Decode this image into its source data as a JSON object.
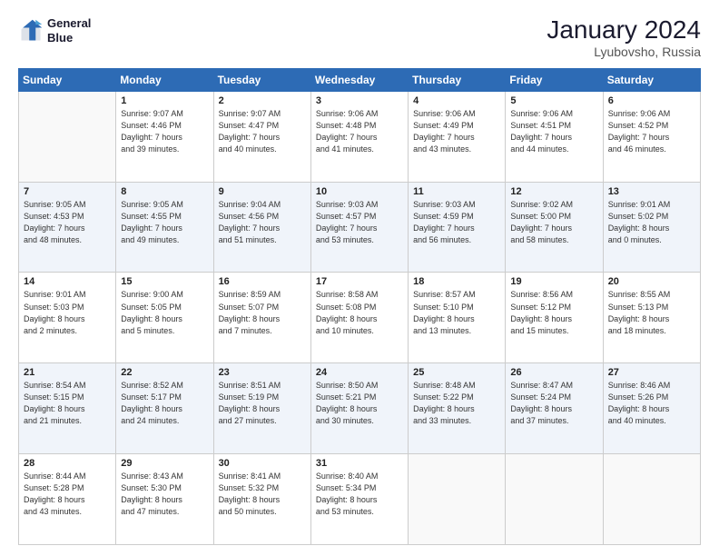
{
  "header": {
    "logo_line1": "General",
    "logo_line2": "Blue",
    "month": "January 2024",
    "location": "Lyubovsho, Russia"
  },
  "weekdays": [
    "Sunday",
    "Monday",
    "Tuesday",
    "Wednesday",
    "Thursday",
    "Friday",
    "Saturday"
  ],
  "weeks": [
    [
      {
        "day": "",
        "info": ""
      },
      {
        "day": "1",
        "info": "Sunrise: 9:07 AM\nSunset: 4:46 PM\nDaylight: 7 hours\nand 39 minutes."
      },
      {
        "day": "2",
        "info": "Sunrise: 9:07 AM\nSunset: 4:47 PM\nDaylight: 7 hours\nand 40 minutes."
      },
      {
        "day": "3",
        "info": "Sunrise: 9:06 AM\nSunset: 4:48 PM\nDaylight: 7 hours\nand 41 minutes."
      },
      {
        "day": "4",
        "info": "Sunrise: 9:06 AM\nSunset: 4:49 PM\nDaylight: 7 hours\nand 43 minutes."
      },
      {
        "day": "5",
        "info": "Sunrise: 9:06 AM\nSunset: 4:51 PM\nDaylight: 7 hours\nand 44 minutes."
      },
      {
        "day": "6",
        "info": "Sunrise: 9:06 AM\nSunset: 4:52 PM\nDaylight: 7 hours\nand 46 minutes."
      }
    ],
    [
      {
        "day": "7",
        "info": "Sunrise: 9:05 AM\nSunset: 4:53 PM\nDaylight: 7 hours\nand 48 minutes."
      },
      {
        "day": "8",
        "info": "Sunrise: 9:05 AM\nSunset: 4:55 PM\nDaylight: 7 hours\nand 49 minutes."
      },
      {
        "day": "9",
        "info": "Sunrise: 9:04 AM\nSunset: 4:56 PM\nDaylight: 7 hours\nand 51 minutes."
      },
      {
        "day": "10",
        "info": "Sunrise: 9:03 AM\nSunset: 4:57 PM\nDaylight: 7 hours\nand 53 minutes."
      },
      {
        "day": "11",
        "info": "Sunrise: 9:03 AM\nSunset: 4:59 PM\nDaylight: 7 hours\nand 56 minutes."
      },
      {
        "day": "12",
        "info": "Sunrise: 9:02 AM\nSunset: 5:00 PM\nDaylight: 7 hours\nand 58 minutes."
      },
      {
        "day": "13",
        "info": "Sunrise: 9:01 AM\nSunset: 5:02 PM\nDaylight: 8 hours\nand 0 minutes."
      }
    ],
    [
      {
        "day": "14",
        "info": "Sunrise: 9:01 AM\nSunset: 5:03 PM\nDaylight: 8 hours\nand 2 minutes."
      },
      {
        "day": "15",
        "info": "Sunrise: 9:00 AM\nSunset: 5:05 PM\nDaylight: 8 hours\nand 5 minutes."
      },
      {
        "day": "16",
        "info": "Sunrise: 8:59 AM\nSunset: 5:07 PM\nDaylight: 8 hours\nand 7 minutes."
      },
      {
        "day": "17",
        "info": "Sunrise: 8:58 AM\nSunset: 5:08 PM\nDaylight: 8 hours\nand 10 minutes."
      },
      {
        "day": "18",
        "info": "Sunrise: 8:57 AM\nSunset: 5:10 PM\nDaylight: 8 hours\nand 13 minutes."
      },
      {
        "day": "19",
        "info": "Sunrise: 8:56 AM\nSunset: 5:12 PM\nDaylight: 8 hours\nand 15 minutes."
      },
      {
        "day": "20",
        "info": "Sunrise: 8:55 AM\nSunset: 5:13 PM\nDaylight: 8 hours\nand 18 minutes."
      }
    ],
    [
      {
        "day": "21",
        "info": "Sunrise: 8:54 AM\nSunset: 5:15 PM\nDaylight: 8 hours\nand 21 minutes."
      },
      {
        "day": "22",
        "info": "Sunrise: 8:52 AM\nSunset: 5:17 PM\nDaylight: 8 hours\nand 24 minutes."
      },
      {
        "day": "23",
        "info": "Sunrise: 8:51 AM\nSunset: 5:19 PM\nDaylight: 8 hours\nand 27 minutes."
      },
      {
        "day": "24",
        "info": "Sunrise: 8:50 AM\nSunset: 5:21 PM\nDaylight: 8 hours\nand 30 minutes."
      },
      {
        "day": "25",
        "info": "Sunrise: 8:48 AM\nSunset: 5:22 PM\nDaylight: 8 hours\nand 33 minutes."
      },
      {
        "day": "26",
        "info": "Sunrise: 8:47 AM\nSunset: 5:24 PM\nDaylight: 8 hours\nand 37 minutes."
      },
      {
        "day": "27",
        "info": "Sunrise: 8:46 AM\nSunset: 5:26 PM\nDaylight: 8 hours\nand 40 minutes."
      }
    ],
    [
      {
        "day": "28",
        "info": "Sunrise: 8:44 AM\nSunset: 5:28 PM\nDaylight: 8 hours\nand 43 minutes."
      },
      {
        "day": "29",
        "info": "Sunrise: 8:43 AM\nSunset: 5:30 PM\nDaylight: 8 hours\nand 47 minutes."
      },
      {
        "day": "30",
        "info": "Sunrise: 8:41 AM\nSunset: 5:32 PM\nDaylight: 8 hours\nand 50 minutes."
      },
      {
        "day": "31",
        "info": "Sunrise: 8:40 AM\nSunset: 5:34 PM\nDaylight: 8 hours\nand 53 minutes."
      },
      {
        "day": "",
        "info": ""
      },
      {
        "day": "",
        "info": ""
      },
      {
        "day": "",
        "info": ""
      }
    ]
  ]
}
